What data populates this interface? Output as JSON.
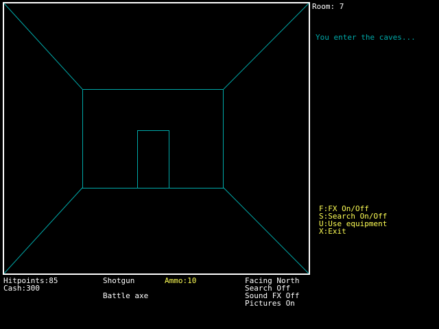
{
  "colors": {
    "background": "#000000",
    "frame": "#ffffff",
    "wireframe": "#00aaaa",
    "message": "#00aaaa",
    "menu": "#ffff55",
    "ammo": "#ffff55",
    "status_text": "#ffffff"
  },
  "room": {
    "label": "Room:",
    "number": "7"
  },
  "message": "You enter the caves...",
  "menu": {
    "items": [
      {
        "label": "F:FX On/Off"
      },
      {
        "label": "S:Search On/Off"
      },
      {
        "label": "U:Use equipment"
      },
      {
        "label": "X:Exit"
      }
    ]
  },
  "stats": {
    "hitpoints": "Hitpoints:85",
    "cash": "Cash:300"
  },
  "weapons": {
    "primary": "Shotgun",
    "secondary": "Battle axe",
    "ammo": "Ammo:10"
  },
  "status": {
    "facing": "Facing North",
    "search": "Search Off",
    "sound": "Sound FX Off",
    "pictures": "Pictures On"
  }
}
